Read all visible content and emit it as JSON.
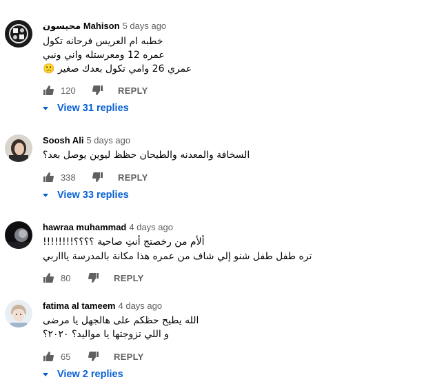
{
  "comments": [
    {
      "arabic_prefix": "محيسون",
      "author": "Mahison",
      "time": "5 days ago",
      "lines": [
        "خطبه ام العريس فرحانه تكول",
        "عمره 12 ومعرستله واني ونبي",
        "عمري 26 وامي تكول بعدك صغير 🙁"
      ],
      "likes": "120",
      "reply_label": "REPLY",
      "view_replies": "View 31 replies"
    },
    {
      "author": "Soosh Ali",
      "time": "5 days ago",
      "lines": [
        "السخافة والمعدنه والطيحان حظظ ليوين يوصل بعد؟"
      ],
      "likes": "338",
      "reply_label": "REPLY",
      "view_replies": "View 33 replies"
    },
    {
      "author": "hawraa muhammad",
      "time": "4 days ago",
      "lines": [
        "ألأم من رخصتج أنتِ صاحية ؟؟؟؟!!!!!!!!",
        "تره طفل طفل شنو إلي شاف من عمره هذا مكانة بالمدرسة ياااربي"
      ],
      "likes": "80",
      "reply_label": "REPLY"
    },
    {
      "author": "fatima al tameem",
      "time": "4 days ago",
      "lines": [
        "الله يطيح حظكم على هالجهل يا مرضى",
        "و اللي تزوجتها يا مواليد؟ ٢٠٢٠؟"
      ],
      "likes": "65",
      "reply_label": "REPLY",
      "view_replies": "View 2 replies"
    }
  ],
  "icons": {
    "like": "thumbs-up-icon",
    "dislike": "thumbs-down-icon",
    "expand": "caret-down-icon"
  },
  "colors": {
    "link": "#065fd4",
    "meta": "#606060",
    "text": "#030303"
  }
}
